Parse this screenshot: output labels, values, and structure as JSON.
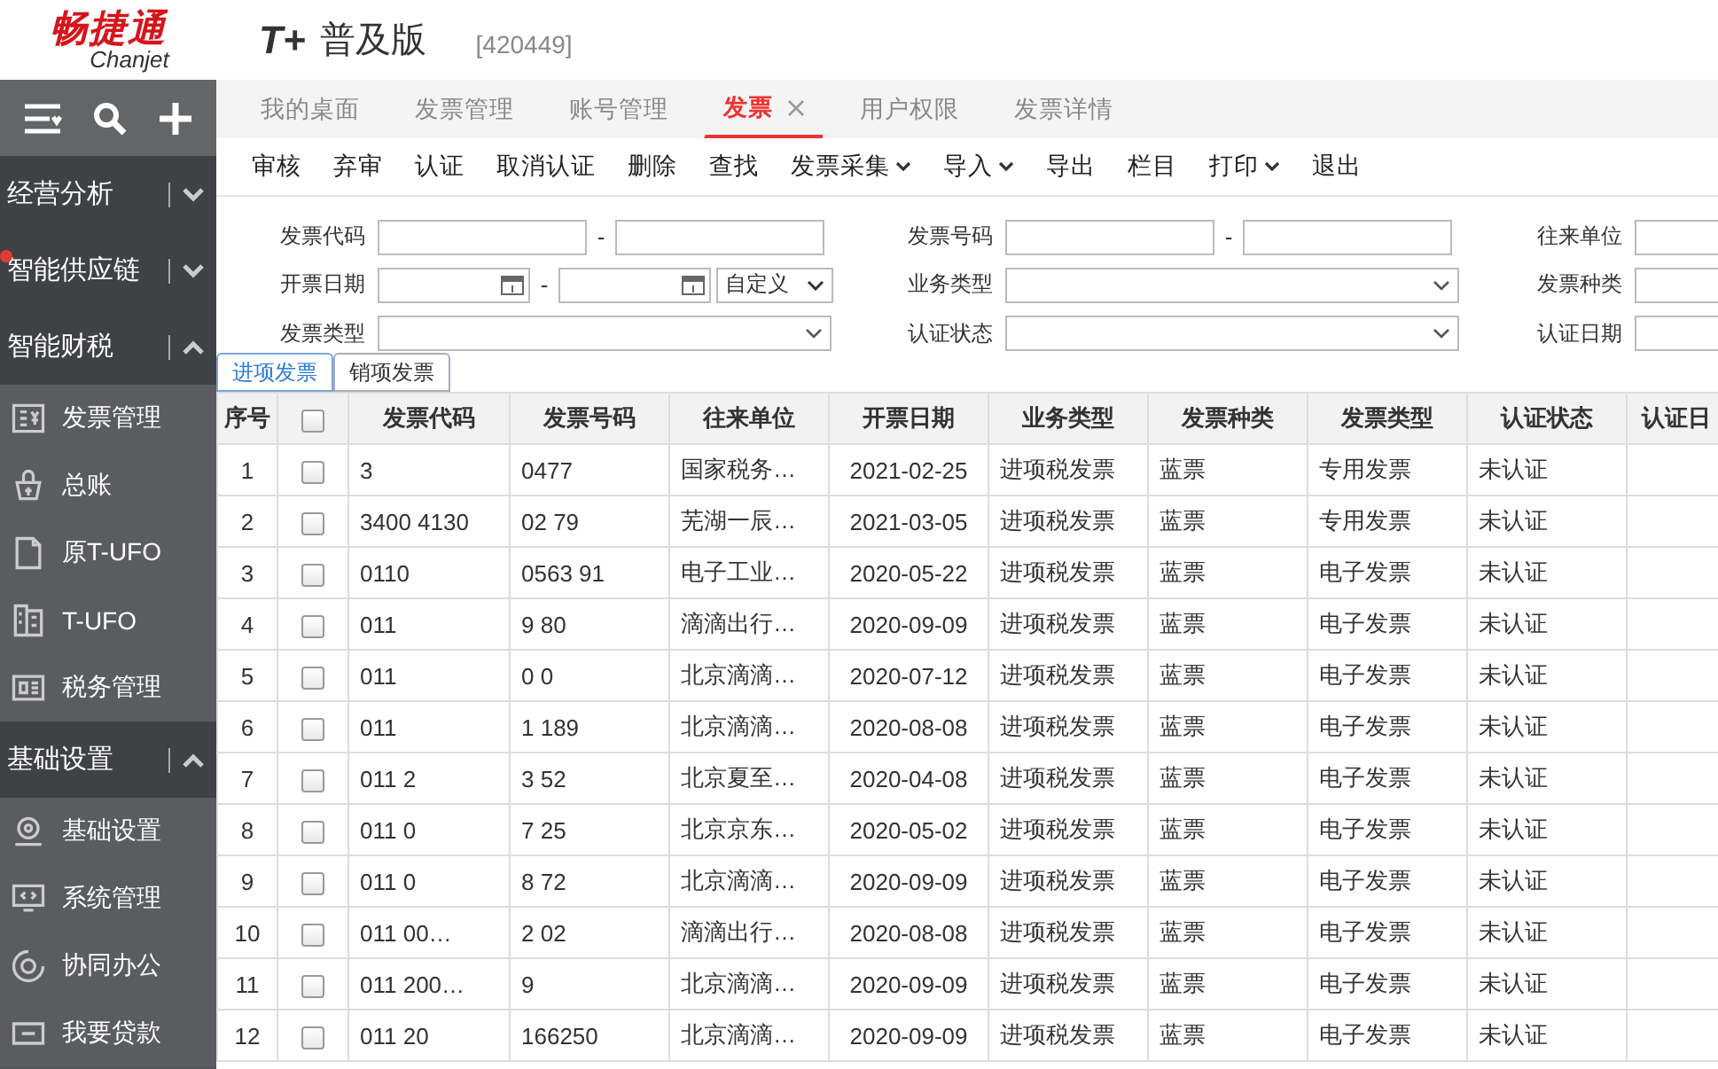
{
  "header": {
    "logo_cn": "畅捷通",
    "logo_en": "Chanjet",
    "product_mark": "T+",
    "product_name": "普及版",
    "account": "[420449]"
  },
  "sidebar": {
    "sections": [
      {
        "label": "经营分析",
        "expanded": false,
        "alert": false
      },
      {
        "label": "智能供应链",
        "expanded": false,
        "alert": true
      },
      {
        "label": "智能财税",
        "expanded": true,
        "alert": false,
        "items": [
          "发票管理",
          "总账",
          "原T-UFO",
          "T-UFO",
          "税务管理"
        ]
      },
      {
        "label": "基础设置",
        "expanded": true,
        "alert": false,
        "items": [
          "基础设置",
          "系统管理",
          "协同办公",
          "我要贷款"
        ]
      }
    ]
  },
  "tabs": [
    {
      "label": "我的桌面",
      "selected": false
    },
    {
      "label": "发票管理",
      "selected": false
    },
    {
      "label": "账号管理",
      "selected": false
    },
    {
      "label": "发票",
      "selected": true
    },
    {
      "label": "用户权限",
      "selected": false
    },
    {
      "label": "发票详情",
      "selected": false
    }
  ],
  "toolbar": [
    {
      "label": "审核",
      "dropdown": false
    },
    {
      "label": "弃审",
      "dropdown": false
    },
    {
      "label": "认证",
      "dropdown": false
    },
    {
      "label": "取消认证",
      "dropdown": false
    },
    {
      "label": "删除",
      "dropdown": false
    },
    {
      "label": "查找",
      "dropdown": false
    },
    {
      "label": "发票采集",
      "dropdown": true
    },
    {
      "label": "导入",
      "dropdown": true
    },
    {
      "label": "导出",
      "dropdown": false
    },
    {
      "label": "栏目",
      "dropdown": false
    },
    {
      "label": "打印",
      "dropdown": true
    },
    {
      "label": "退出",
      "dropdown": false
    }
  ],
  "filters": [
    [
      {
        "label": "发票代码",
        "kind": "range",
        "separator": "-"
      },
      {
        "label": "发票号码",
        "kind": "range",
        "separator": "-"
      },
      {
        "label": "往来单位",
        "kind": "input"
      }
    ],
    [
      {
        "label": "开票日期",
        "kind": "daterange",
        "separator": "-",
        "value": "自定义"
      },
      {
        "label": "业务类型",
        "kind": "select"
      },
      {
        "label": "发票种类",
        "kind": "input"
      }
    ],
    [
      {
        "label": "发票类型",
        "kind": "select"
      },
      {
        "label": "认证状态",
        "kind": "select"
      },
      {
        "label": "认证日期",
        "kind": "input"
      }
    ]
  ],
  "subtabs": [
    {
      "label": "进项发票",
      "selected": true
    },
    {
      "label": "销项发票",
      "selected": false
    }
  ],
  "table": {
    "all_checked": false,
    "columns": [
      "序号",
      "发票代码",
      "发票号码",
      "往来单位",
      "开票日期",
      "业务类型",
      "发票种类",
      "发票类型",
      "认证状态",
      "认证日"
    ],
    "rows": [
      {
        "cells": [
          "1",
          "3",
          "0477",
          "国家税务…",
          "2021-02-25",
          "进项税发票",
          "蓝票",
          "专用发票",
          "未认证"
        ],
        "checked": false
      },
      {
        "cells": [
          "2",
          "3400 4130",
          "02 79",
          "芜湖一辰…",
          "2021-03-05",
          "进项税发票",
          "蓝票",
          "专用发票",
          "未认证"
        ],
        "checked": false
      },
      {
        "cells": [
          "3",
          "0110",
          "0563 91",
          "电子工业…",
          "2020-05-22",
          "进项税发票",
          "蓝票",
          "电子发票",
          "未认证"
        ],
        "checked": false
      },
      {
        "cells": [
          "4",
          "011",
          "9 80",
          "滴滴出行…",
          "2020-09-09",
          "进项税发票",
          "蓝票",
          "电子发票",
          "未认证"
        ],
        "checked": false
      },
      {
        "cells": [
          "5",
          "011",
          "0 0",
          "北京滴滴…",
          "2020-07-12",
          "进项税发票",
          "蓝票",
          "电子发票",
          "未认证"
        ],
        "checked": false
      },
      {
        "cells": [
          "6",
          "011",
          "1 189",
          "北京滴滴…",
          "2020-08-08",
          "进项税发票",
          "蓝票",
          "电子发票",
          "未认证"
        ],
        "checked": false
      },
      {
        "cells": [
          "7",
          "011 2",
          "3 52",
          "北京夏至…",
          "2020-04-08",
          "进项税发票",
          "蓝票",
          "电子发票",
          "未认证"
        ],
        "checked": false
      },
      {
        "cells": [
          "8",
          "011 0",
          "7 25",
          "北京京东…",
          "2020-05-02",
          "进项税发票",
          "蓝票",
          "电子发票",
          "未认证"
        ],
        "checked": false
      },
      {
        "cells": [
          "9",
          "011 0",
          "8 72",
          "北京滴滴…",
          "2020-09-09",
          "进项税发票",
          "蓝票",
          "电子发票",
          "未认证"
        ],
        "checked": false
      },
      {
        "cells": [
          "10",
          "011 00…",
          "2 02",
          "滴滴出行…",
          "2020-08-08",
          "进项税发票",
          "蓝票",
          "电子发票",
          "未认证"
        ],
        "checked": false
      },
      {
        "cells": [
          "11",
          "011 200…",
          "9",
          "北京滴滴…",
          "2020-09-09",
          "进项税发票",
          "蓝票",
          "电子发票",
          "未认证"
        ],
        "checked": false
      },
      {
        "cells": [
          "12",
          "011 20",
          "166250",
          "北京滴滴…",
          "2020-09-09",
          "进项税发票",
          "蓝票",
          "电子发票",
          "未认证"
        ],
        "checked": false
      }
    ]
  }
}
